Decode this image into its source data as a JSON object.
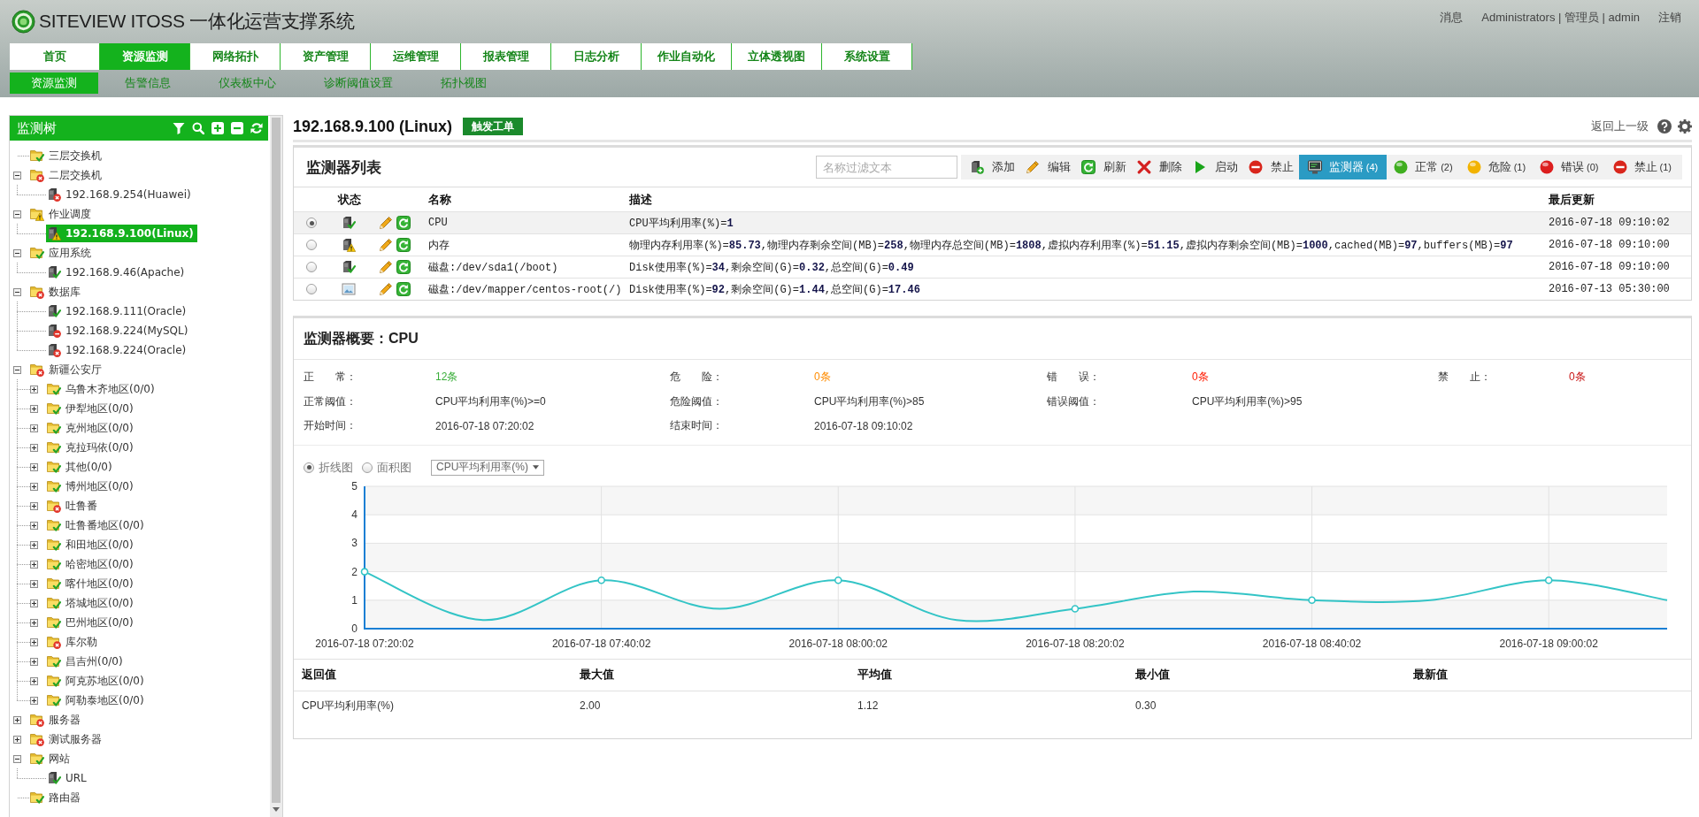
{
  "header": {
    "title": "SITEVIEW ITOSS 一体化运营支撑系统",
    "links": [
      "消息",
      "Administrators | 管理员 | admin",
      "注销"
    ]
  },
  "nav": {
    "tabs": [
      {
        "label": "首页",
        "selected": false
      },
      {
        "label": "资源监测",
        "selected": true
      },
      {
        "label": "网络拓扑",
        "selected": false
      },
      {
        "label": "资产管理",
        "selected": false
      },
      {
        "label": "运维管理",
        "selected": false
      },
      {
        "label": "报表管理",
        "selected": false
      },
      {
        "label": "日志分析",
        "selected": false
      },
      {
        "label": "作业自动化",
        "selected": false
      },
      {
        "label": "立体透视图",
        "selected": false
      },
      {
        "label": "系统设置",
        "selected": false
      }
    ]
  },
  "subnav": {
    "tabs": [
      {
        "label": "资源监测",
        "selected": true
      },
      {
        "label": "告警信息",
        "selected": false
      },
      {
        "label": "仪表板中心",
        "selected": false
      },
      {
        "label": "诊断阈值设置",
        "selected": false
      },
      {
        "label": "拓扑视图",
        "selected": false
      }
    ]
  },
  "sidebar": {
    "title": "监测树",
    "tree": [
      {
        "label": "三层交换机",
        "kind": "folder_ok",
        "selected": false
      },
      {
        "label": "二层交换机",
        "kind": "folder_error",
        "selected": false,
        "expanded": true,
        "children": [
          {
            "label": "192.168.9.254(Huawei)",
            "kind": "server_error",
            "selected": false
          }
        ]
      },
      {
        "label": "作业调度",
        "kind": "folder_warning",
        "selected": false,
        "expanded": true,
        "children": [
          {
            "label": "192.168.9.100(Linux)",
            "kind": "server_warning",
            "selected": true
          }
        ]
      },
      {
        "label": "应用系统",
        "kind": "folder_ok",
        "selected": false,
        "expanded": true,
        "children": [
          {
            "label": "192.168.9.46(Apache)",
            "kind": "server_ok",
            "selected": false
          }
        ]
      },
      {
        "label": "数据库",
        "kind": "folder_error",
        "selected": false,
        "expanded": true,
        "children": [
          {
            "label": "192.168.9.111(Oracle)",
            "kind": "server_ok",
            "selected": false
          },
          {
            "label": "192.168.9.224(MySQL)",
            "kind": "server_disabled",
            "selected": false
          },
          {
            "label": "192.168.9.224(Oracle)",
            "kind": "server_error",
            "selected": false
          }
        ]
      },
      {
        "label": "新疆公安厅",
        "kind": "folder_error",
        "selected": false,
        "expanded": true,
        "children": [
          {
            "label": "乌鲁木齐地区(0/0)",
            "kind": "folder_ok",
            "selected": false,
            "expanded": false
          },
          {
            "label": "伊犁地区(0/0)",
            "kind": "folder_ok",
            "selected": false,
            "expanded": false
          },
          {
            "label": "克州地区(0/0)",
            "kind": "folder_ok",
            "selected": false,
            "expanded": false
          },
          {
            "label": "克拉玛依(0/0)",
            "kind": "folder_ok",
            "selected": false,
            "expanded": false
          },
          {
            "label": "其他(0/0)",
            "kind": "folder_ok",
            "selected": false,
            "expanded": false
          },
          {
            "label": "博州地区(0/0)",
            "kind": "folder_ok",
            "selected": false,
            "expanded": false
          },
          {
            "label": "吐鲁番",
            "kind": "folder_error",
            "selected": false,
            "expanded": false
          },
          {
            "label": "吐鲁番地区(0/0)",
            "kind": "folder_ok",
            "selected": false,
            "expanded": false
          },
          {
            "label": "和田地区(0/0)",
            "kind": "folder_ok",
            "selected": false,
            "expanded": false
          },
          {
            "label": "哈密地区(0/0)",
            "kind": "folder_ok",
            "selected": false,
            "expanded": false
          },
          {
            "label": "喀什地区(0/0)",
            "kind": "folder_ok",
            "selected": false,
            "expanded": false
          },
          {
            "label": "塔城地区(0/0)",
            "kind": "folder_ok",
            "selected": false,
            "expanded": false
          },
          {
            "label": "巴州地区(0/0)",
            "kind": "folder_ok",
            "selected": false,
            "expanded": false
          },
          {
            "label": "库尔勒",
            "kind": "folder_error",
            "selected": false,
            "expanded": false
          },
          {
            "label": "昌吉州(0/0)",
            "kind": "folder_ok",
            "selected": false,
            "expanded": false
          },
          {
            "label": "阿克苏地区(0/0)",
            "kind": "folder_ok",
            "selected": false,
            "expanded": false
          },
          {
            "label": "阿勒泰地区(0/0)",
            "kind": "folder_ok",
            "selected": false,
            "expanded": false
          }
        ]
      },
      {
        "label": "服务器",
        "kind": "folder_error",
        "selected": false,
        "expanded": false
      },
      {
        "label": "测试服务器",
        "kind": "folder_error",
        "selected": false,
        "expanded": false
      },
      {
        "label": "网站",
        "kind": "folder_ok",
        "selected": false,
        "expanded": true,
        "children": [
          {
            "label": "URL",
            "kind": "server_ok",
            "selected": false
          }
        ]
      },
      {
        "label": "路由器",
        "kind": "folder_ok",
        "selected": false
      }
    ]
  },
  "page": {
    "title": "192.168.9.100 (Linux)",
    "action": "触发工单",
    "back": "返回上一级"
  },
  "monitor_list": {
    "title": "监测器列表",
    "filter": {
      "placeholder": "名称过滤文本"
    },
    "actions": [
      {
        "kind": "add",
        "label": "添加"
      },
      {
        "kind": "edit",
        "label": "编辑"
      },
      {
        "kind": "refresh",
        "label": "刷新"
      },
      {
        "kind": "delete",
        "label": "删除"
      },
      {
        "kind": "start",
        "label": "启动"
      },
      {
        "kind": "disable",
        "label": "禁止"
      }
    ],
    "filters": [
      {
        "kind": "all",
        "label": "监测器",
        "count": "(4)",
        "selected": true
      },
      {
        "kind": "ok",
        "label": "正常",
        "count": "(2)",
        "selected": false
      },
      {
        "kind": "warning",
        "label": "危险",
        "count": "(1)",
        "selected": false
      },
      {
        "kind": "error",
        "label": "错误",
        "count": "(0)",
        "selected": false
      },
      {
        "kind": "disabled",
        "label": "禁止",
        "count": "(1)",
        "selected": false
      }
    ],
    "columns": [
      "状态",
      "名称",
      "描述",
      "最后更新"
    ],
    "rows": [
      {
        "selected": true,
        "kind": "server_ok",
        "name": "CPU",
        "description": "CPU平均利用率(%)=**1**",
        "updated": "2016-07-18 09:10:02"
      },
      {
        "selected": false,
        "kind": "server_warning",
        "name": "内存",
        "description": "物理内存利用率(%)=**85.73**,物理内存剩余空间(MB)=**258**,物理内存总空间(MB)=**1808**,虚拟内存利用率(%)=**51.15**,虚拟内存剩余空间(MB)=**1000**,cached(MB)=**97**,buffers(MB)=**97**",
        "updated": "2016-07-18 09:10:00"
      },
      {
        "selected": false,
        "kind": "server_ok",
        "name": "磁盘:/dev/sda1(/boot)",
        "description": "Disk使用率(%)=**34**,剩余空间(G)=**0.32**,总空间(G)=**0.49**",
        "updated": "2016-07-18 09:10:00"
      },
      {
        "selected": false,
        "kind": "picture",
        "name": "磁盘:/dev/mapper/centos-root(/)",
        "description": "Disk使用率(%)=**92**,剩余空间(G)=**1.44**,总空间(G)=**17.46**",
        "updated": "2016-07-13 05:30:00"
      }
    ]
  },
  "summary": {
    "title": "监测器概要：CPU",
    "counts": [
      {
        "label": "正　　常：",
        "value": "12条",
        "color": "#3aae3a"
      },
      {
        "label": "危　　险：",
        "value": "0条",
        "color": "#ff8c00"
      },
      {
        "label": "错　　误：",
        "value": "0条",
        "color": "#ff1a00"
      },
      {
        "label": "禁　　止：",
        "value": "0条",
        "color": "#c81414"
      }
    ],
    "thresholds": [
      {
        "label": "正常阈值：",
        "value": "CPU平均利用率(%)>=0"
      },
      {
        "label": "危险阈值：",
        "value": "CPU平均利用率(%)>85"
      },
      {
        "label": "错误阈值：",
        "value": "CPU平均利用率(%)>95"
      }
    ],
    "times": [
      {
        "label": "开始时间：",
        "value": "2016-07-18 07:20:02"
      },
      {
        "label": "结束时间：",
        "value": "2016-07-18 09:10:02"
      }
    ],
    "chart_modes": [
      {
        "kind": "line",
        "label": "折线图",
        "selected": true
      },
      {
        "kind": "area",
        "label": "面积图",
        "selected": false
      }
    ],
    "metric_select": {
      "value": "CPU平均利用率(%)"
    },
    "chart_data": {
      "type": "line",
      "categories": [
        "2016-07-18 07:20:02",
        null,
        "2016-07-18 07:40:02",
        null,
        "2016-07-18 08:00:02",
        null,
        "2016-07-18 08:20:02",
        null,
        "2016-07-18 08:40:02",
        null,
        "2016-07-18 09:00:02",
        null
      ],
      "series": [
        {
          "color": "#33c4c6",
          "values": [
            2,
            0.3,
            1.7,
            0.7,
            1.7,
            0.3,
            0.7,
            1.3,
            1,
            1,
            1.7,
            1
          ]
        }
      ],
      "ylim": [
        0,
        5
      ],
      "yticks": [
        0,
        1,
        2,
        3,
        4,
        5
      ],
      "grid": true
    },
    "stats": {
      "columns": [
        "返回值",
        "最大值",
        "平均值",
        "最小值",
        "最新值"
      ],
      "rows": [
        [
          "CPU平均利用率(%)",
          "2.00",
          "1.12",
          "0.30"
        ]
      ]
    }
  }
}
